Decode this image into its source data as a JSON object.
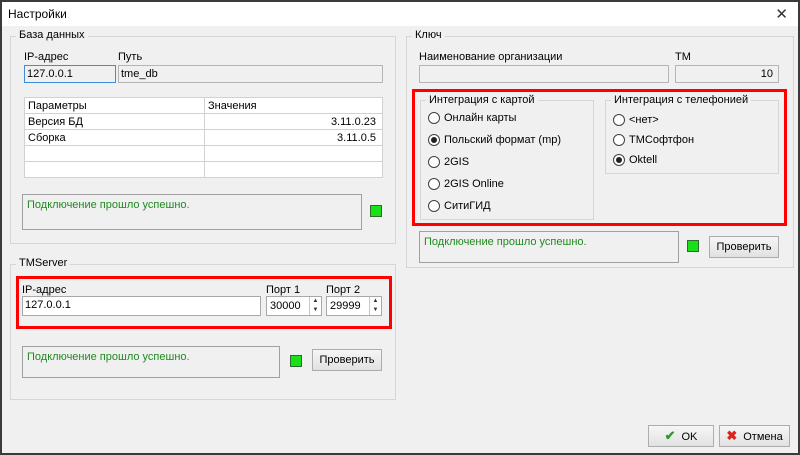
{
  "window": {
    "title": "Настройки",
    "close": "✕"
  },
  "db": {
    "group": "База данных",
    "ip_label": "IP-адрес",
    "ip_value": "127.0.0.1",
    "path_label": "Путь",
    "path_value": "tme_db",
    "table": {
      "headers": [
        "Параметры",
        "Значения"
      ],
      "rows": [
        [
          "Версия БД",
          "3.11.0.23"
        ],
        [
          "Сборка",
          "3.11.0.5"
        ],
        [
          "",
          ""
        ],
        [
          "",
          ""
        ]
      ]
    },
    "status": "Подключение прошло успешно."
  },
  "tmserver": {
    "group": "TMServer",
    "ip_label": "IP-адрес",
    "ip_value": "127.0.0.1",
    "port1_label": "Порт 1",
    "port1_value": "30000",
    "port2_label": "Порт 2",
    "port2_value": "29999",
    "status": "Подключение прошло успешно.",
    "check_button": "Проверить"
  },
  "key": {
    "group": "Ключ",
    "org_label": "Наименование организации",
    "org_value": "",
    "tm_label": "ТМ",
    "tm_value": "10",
    "map_group": "Интеграция с картой",
    "map_options": [
      "Онлайн карты",
      "Польский формат (mp)",
      "2GIS",
      "2GIS Online",
      "СитиГИД"
    ],
    "map_selected": 1,
    "phone_group": "Интеграция с телефонией",
    "phone_options": [
      "<нет>",
      "ТМСофтфон",
      "Oktell"
    ],
    "phone_selected": 2,
    "status": "Подключение прошло успешно.",
    "check_button": "Проверить"
  },
  "footer": {
    "ok": "OK",
    "cancel": "Отмена"
  }
}
